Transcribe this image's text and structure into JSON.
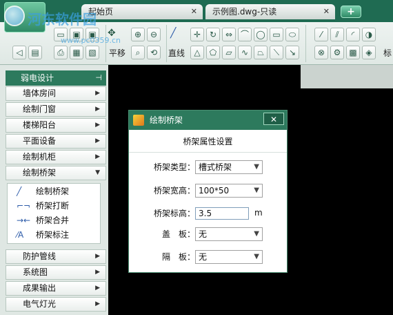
{
  "tabs": {
    "start_label": "起始页",
    "doc_label": "示例图.dwg-只读",
    "close_symbol": "✕",
    "add_symbol": "+"
  },
  "ribbon": {
    "pan_label": "平移",
    "line_label": "直线",
    "right_label": "标"
  },
  "panel": {
    "title": "弱电设计",
    "items_top": [
      {
        "label": "墙体房间"
      },
      {
        "label": "绘制门窗"
      },
      {
        "label": "楼梯阳台"
      },
      {
        "label": "平面设备"
      },
      {
        "label": "绘制机柜"
      }
    ],
    "expanded": {
      "label": "绘制桥架"
    },
    "sub_items": [
      {
        "label": "绘制桥架",
        "icon": "draw-tray-icon"
      },
      {
        "label": "桥架打断",
        "icon": "break-tray-icon"
      },
      {
        "label": "桥架合并",
        "icon": "merge-tray-icon"
      },
      {
        "label": "桥架标注",
        "icon": "annotate-tray-icon"
      }
    ],
    "items_bottom": [
      {
        "label": "防护管线"
      },
      {
        "label": "系统图"
      },
      {
        "label": "成果输出"
      },
      {
        "label": "电气灯光"
      }
    ]
  },
  "dialog": {
    "title": "绘制桥架",
    "close": "✕",
    "heading": "桥架属性设置",
    "type_label": "桥架类型：",
    "type_value": "槽式桥架",
    "width_label": "桥架宽高：",
    "width_value": "100*50",
    "elev_label": "桥架标高：",
    "elev_value": "3.5",
    "elev_unit": "m",
    "cover_label": "盖　板：",
    "cover_value": "无",
    "partition_label": "隔　板：",
    "partition_value": "无"
  },
  "watermark": {
    "text": "河东软件园",
    "url": "www.pc0359.cn"
  },
  "colors": {
    "accent": "#2d7a5d",
    "canvas": "#000000"
  }
}
